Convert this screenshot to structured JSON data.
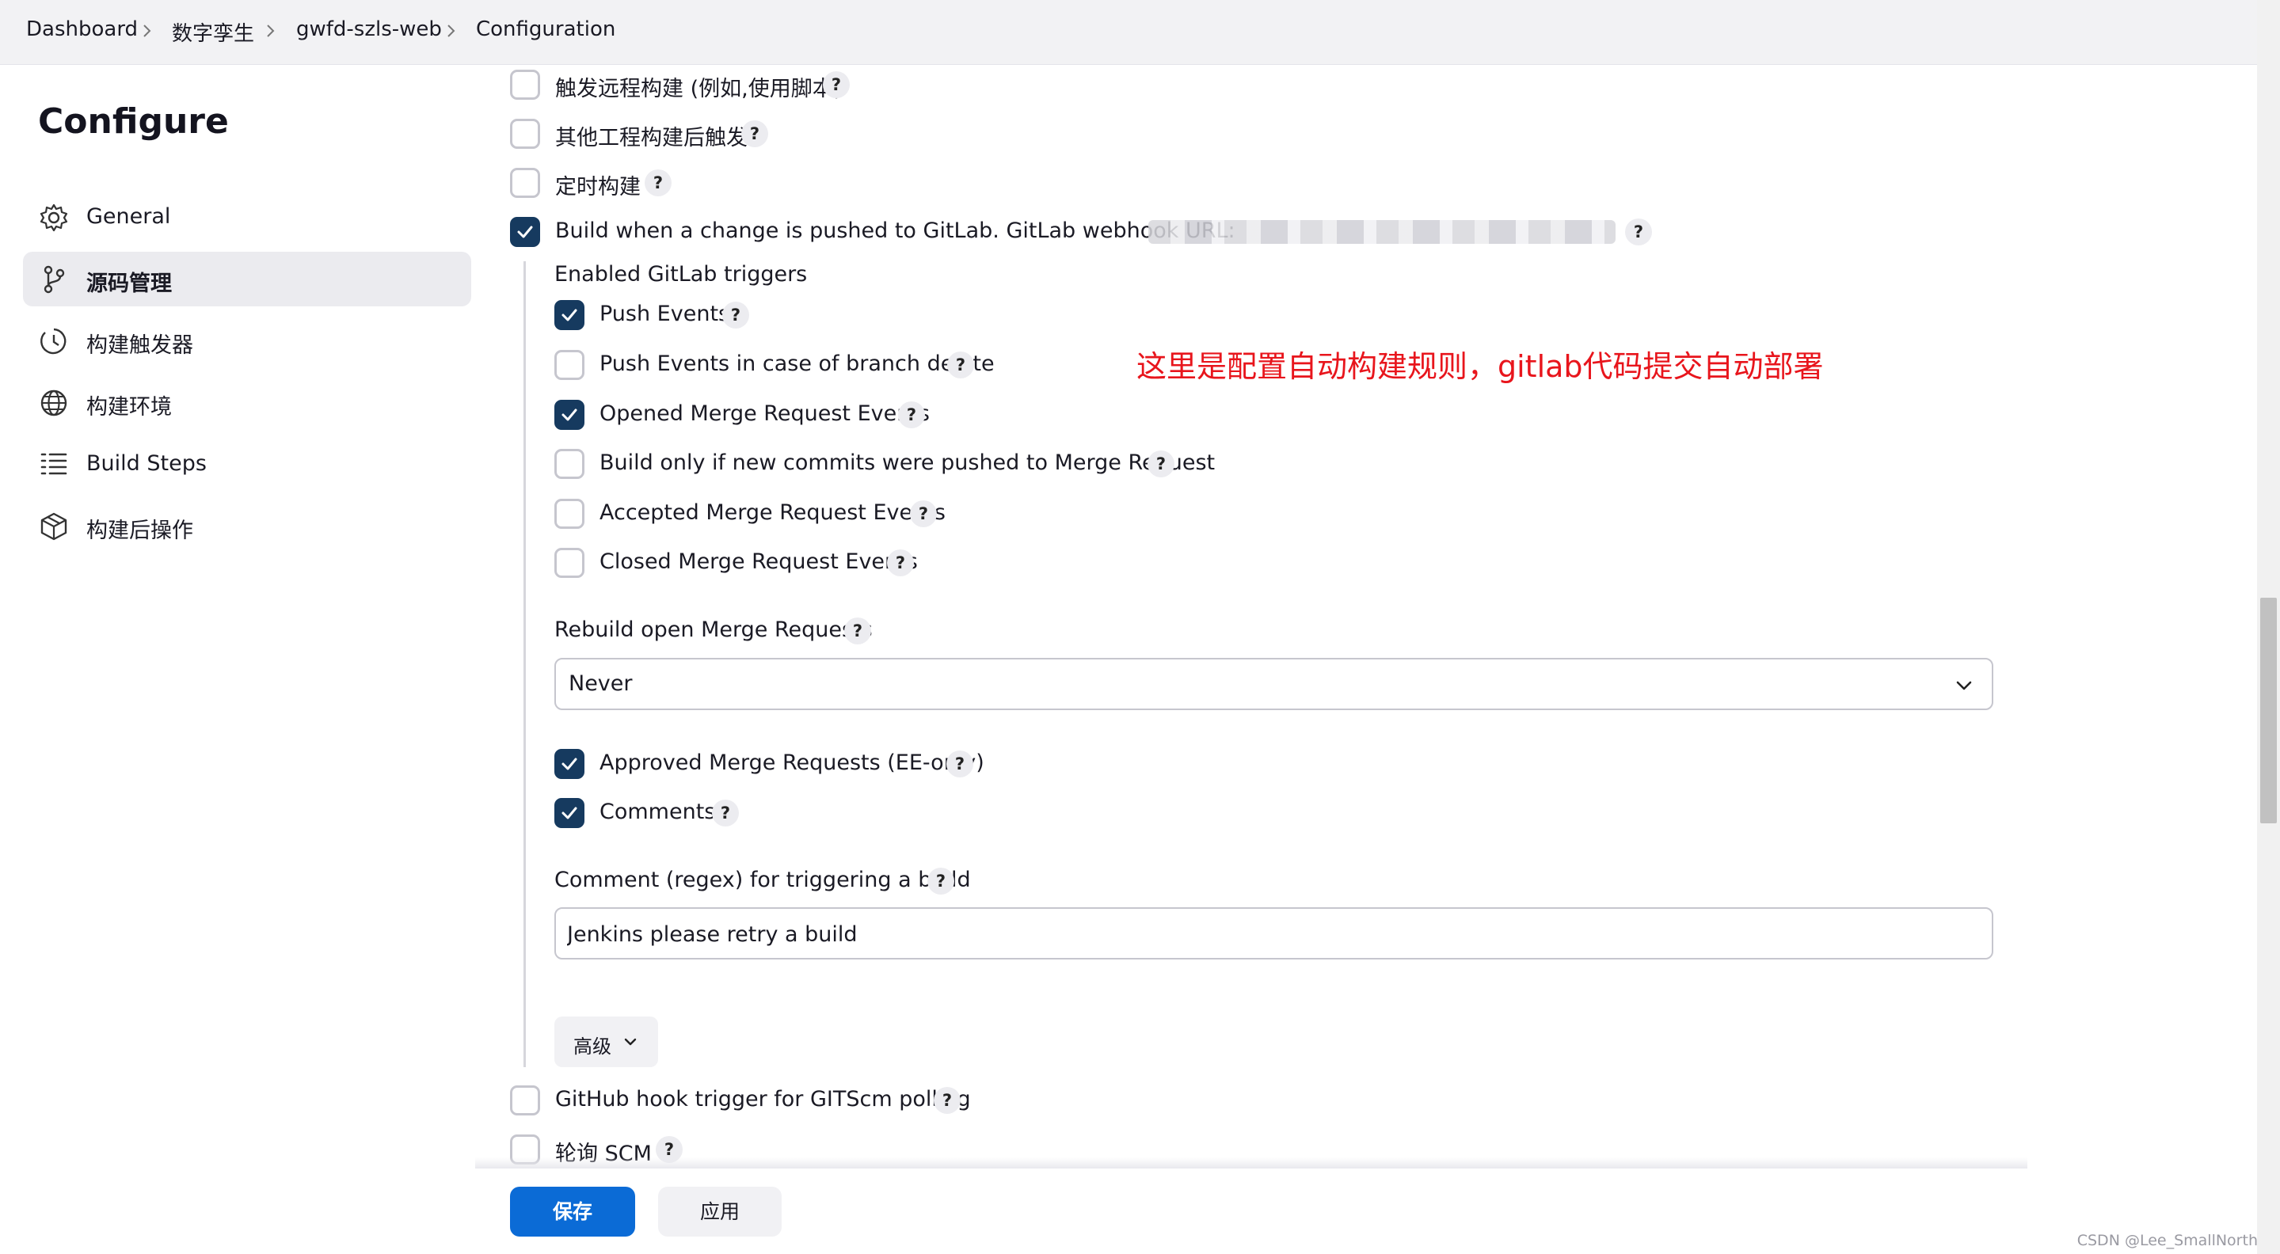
{
  "breadcrumb": {
    "items": [
      "Dashboard",
      "数字孪生",
      "gwfd-szls-web",
      "Configuration"
    ]
  },
  "sidebar": {
    "title": "Configure",
    "items": [
      {
        "label": "General",
        "icon": "gear-icon",
        "active": false
      },
      {
        "label": "源码管理",
        "icon": "source-branch-icon",
        "active": true
      },
      {
        "label": "构建触发器",
        "icon": "clock-icon",
        "active": false
      },
      {
        "label": "构建环境",
        "icon": "globe-icon",
        "active": false
      },
      {
        "label": "Build Steps",
        "icon": "list-icon",
        "active": false
      },
      {
        "label": "构建后操作",
        "icon": "package-icon",
        "active": false
      }
    ]
  },
  "triggers": {
    "remote": {
      "label": "触发远程构建 (例如,使用脚本)",
      "checked": false
    },
    "after_other": {
      "label": "其他工程构建后触发",
      "checked": false
    },
    "periodic": {
      "label": "定时构建",
      "checked": false
    },
    "gitlab": {
      "label": "Build when a change is pushed to GitLab. GitLab webhook URL:",
      "checked": true
    },
    "github_hook": {
      "label": "GitHub hook trigger for GITScm polling",
      "checked": false
    },
    "poll_scm": {
      "label": "轮询 SCM",
      "checked": false
    }
  },
  "gitlab": {
    "enabled_triggers_label": "Enabled GitLab triggers",
    "options": [
      {
        "label": "Push Events",
        "checked": true
      },
      {
        "label": "Push Events in case of branch delete",
        "checked": false
      },
      {
        "label": "Opened Merge Request Events",
        "checked": true
      },
      {
        "label": "Build only if new commits were pushed to Merge Request",
        "checked": false
      },
      {
        "label": "Accepted Merge Request Events",
        "checked": false
      },
      {
        "label": "Closed Merge Request Events",
        "checked": false
      }
    ],
    "rebuild_label": "Rebuild open Merge Requests",
    "rebuild_value": "Never",
    "approved": {
      "label": "Approved Merge Requests (EE-only)",
      "checked": true
    },
    "comments": {
      "label": "Comments",
      "checked": true
    },
    "comment_regex_label": "Comment (regex) for triggering a build",
    "comment_regex_value": "Jenkins please retry a build",
    "advanced_label": "高级"
  },
  "annotation": "这里是配置自动构建规则，gitlab代码提交自动部署",
  "help_glyph": "?",
  "buttons": {
    "save": "保存",
    "apply": "应用"
  },
  "watermark": "CSDN @Lee_SmallNorth",
  "colors": {
    "primary": "#0b6bd6",
    "checkbox_checked": "#163a5f",
    "annotation": "#e8151c"
  }
}
